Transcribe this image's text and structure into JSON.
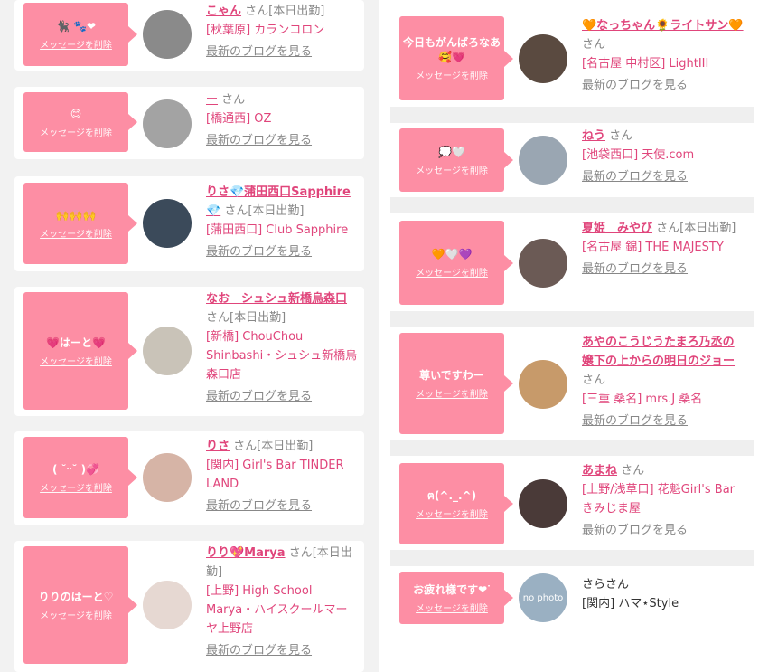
{
  "left": [
    {
      "msg": "🐈‍⬛ 🐾❤",
      "delete": "メッセージを削除",
      "name": "こゃん",
      "san": "さん",
      "status": "[本日出勤]",
      "shop": "[秋葉原] カランコロン",
      "blog": "最新のブログを見る",
      "avatar_color": "#8a8a8a"
    },
    {
      "msg": "😊",
      "delete": "メッセージを削除",
      "name": "ー",
      "san": "さん",
      "status": "",
      "shop": "[橋通西] OZ",
      "blog": "最新のブログを見る",
      "avatar_color": "#a3a3a3"
    },
    {
      "msg": "🙌🙌🙌",
      "delete": "メッセージを削除",
      "name": "りさ💎蒲田西口Sapphire💎",
      "san": "さん",
      "status": "[本日出勤]",
      "shop": "[蒲田西口] Club Sapphire",
      "blog": "最新のブログを見る",
      "avatar_color": "#3b4a5a"
    },
    {
      "msg": "💗はーと💗",
      "delete": "メッセージを削除",
      "name": "なお　シュシュ新橋烏森口",
      "san": "さん",
      "status": "[本日出勤]",
      "shop": "[新橋] ChouChou Shinbashi・シュシュ新橋烏森口店",
      "blog": "最新のブログを見る",
      "avatar_color": "#c9c3b8"
    },
    {
      "msg": "( ˘ᵕ˘ )💞",
      "delete": "メッセージを削除",
      "name": "りさ",
      "san": "さん",
      "status": "[本日出勤]",
      "shop": "[関内] Girl's Bar TINDER LAND",
      "blog": "最新のブログを見る",
      "avatar_color": "#d6b4a6"
    },
    {
      "msg": "りりのはーと♡",
      "delete": "メッセージを削除",
      "name": "りり💖Marya",
      "san": "さん",
      "status": "[本日出勤]",
      "shop": "[上野] High School Marya・ハイスクールマーヤ上野店",
      "blog": "最新のブログを見る",
      "avatar_color": "#e6d8d2"
    }
  ],
  "right": [
    {
      "msg": "今日もがんばろなあ🥰💗",
      "delete": "メッセージを削除",
      "name": "🧡なっちゃん🌻ライトサン🧡",
      "san": "さん",
      "status": "",
      "shop": "[名古屋 中村区] LightIII",
      "blog": "最新のブログを見る",
      "avatar_color": "#5a4a40"
    },
    {
      "msg": "💭🤍",
      "delete": "メッセージを削除",
      "name": "ねう",
      "san": "さん",
      "status": "",
      "shop": "[池袋西口] 天使.com",
      "blog": "最新のブログを見る",
      "avatar_color": "#9aa6b2"
    },
    {
      "msg": "🧡🤍💜",
      "delete": "メッセージを削除",
      "name": "夏姫　みやび",
      "san": "さん",
      "status": "[本日出勤]",
      "shop": "[名古屋 錦] THE MAJESTY",
      "blog": "最新のブログを見る",
      "avatar_color": "#6b5a55"
    },
    {
      "msg": "尊いですわー",
      "delete": "メッセージを削除",
      "name": "あやのこうじうたまろ乃丞の嬢下の上からの明日のジョー",
      "san": "さん",
      "status": "",
      "shop": "[三重 桑名] mrs.J 桑名",
      "blog": "最新のブログを見る",
      "avatar_color": "#c79a6a"
    },
    {
      "msg": "ฅ(^._.^)",
      "delete": "メッセージを削除",
      "name": "あまね",
      "san": "さん",
      "status": "",
      "shop": "[上野/浅草口] 花魁Girl's Barきみじま屋",
      "blog": "最新のブログを見る",
      "avatar_color": "#4a3a38"
    },
    {
      "msg": "お疲れ様です❤︎ᐝ",
      "delete": "メッセージを削除",
      "name": "さらさん",
      "san": "",
      "status": "",
      "shop": "[関内] ハマ⋆Style",
      "blog": "",
      "avatar_text": "no photo",
      "avatar_color": "#9ab0c2"
    }
  ]
}
